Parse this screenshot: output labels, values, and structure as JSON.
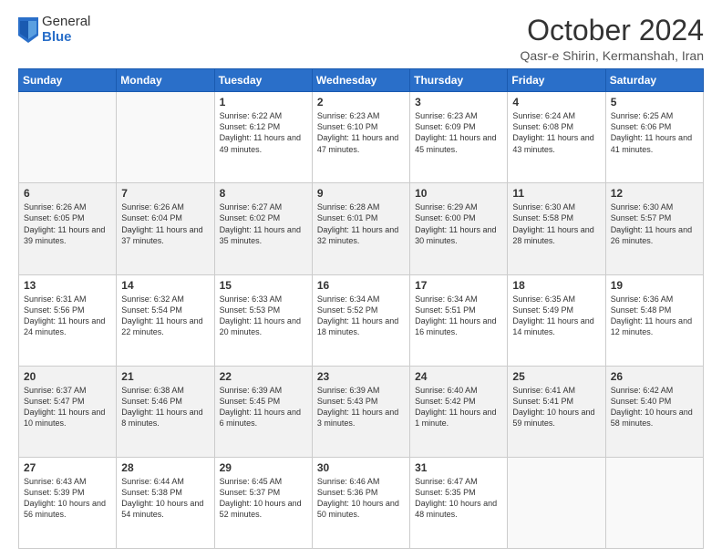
{
  "logo": {
    "general": "General",
    "blue": "Blue"
  },
  "header": {
    "month": "October 2024",
    "location": "Qasr-e Shirin, Kermanshah, Iran"
  },
  "weekdays": [
    "Sunday",
    "Monday",
    "Tuesday",
    "Wednesday",
    "Thursday",
    "Friday",
    "Saturday"
  ],
  "weeks": [
    [
      {
        "day": "",
        "info": ""
      },
      {
        "day": "",
        "info": ""
      },
      {
        "day": "1",
        "info": "Sunrise: 6:22 AM\nSunset: 6:12 PM\nDaylight: 11 hours and 49 minutes."
      },
      {
        "day": "2",
        "info": "Sunrise: 6:23 AM\nSunset: 6:10 PM\nDaylight: 11 hours and 47 minutes."
      },
      {
        "day": "3",
        "info": "Sunrise: 6:23 AM\nSunset: 6:09 PM\nDaylight: 11 hours and 45 minutes."
      },
      {
        "day": "4",
        "info": "Sunrise: 6:24 AM\nSunset: 6:08 PM\nDaylight: 11 hours and 43 minutes."
      },
      {
        "day": "5",
        "info": "Sunrise: 6:25 AM\nSunset: 6:06 PM\nDaylight: 11 hours and 41 minutes."
      }
    ],
    [
      {
        "day": "6",
        "info": "Sunrise: 6:26 AM\nSunset: 6:05 PM\nDaylight: 11 hours and 39 minutes."
      },
      {
        "day": "7",
        "info": "Sunrise: 6:26 AM\nSunset: 6:04 PM\nDaylight: 11 hours and 37 minutes."
      },
      {
        "day": "8",
        "info": "Sunrise: 6:27 AM\nSunset: 6:02 PM\nDaylight: 11 hours and 35 minutes."
      },
      {
        "day": "9",
        "info": "Sunrise: 6:28 AM\nSunset: 6:01 PM\nDaylight: 11 hours and 32 minutes."
      },
      {
        "day": "10",
        "info": "Sunrise: 6:29 AM\nSunset: 6:00 PM\nDaylight: 11 hours and 30 minutes."
      },
      {
        "day": "11",
        "info": "Sunrise: 6:30 AM\nSunset: 5:58 PM\nDaylight: 11 hours and 28 minutes."
      },
      {
        "day": "12",
        "info": "Sunrise: 6:30 AM\nSunset: 5:57 PM\nDaylight: 11 hours and 26 minutes."
      }
    ],
    [
      {
        "day": "13",
        "info": "Sunrise: 6:31 AM\nSunset: 5:56 PM\nDaylight: 11 hours and 24 minutes."
      },
      {
        "day": "14",
        "info": "Sunrise: 6:32 AM\nSunset: 5:54 PM\nDaylight: 11 hours and 22 minutes."
      },
      {
        "day": "15",
        "info": "Sunrise: 6:33 AM\nSunset: 5:53 PM\nDaylight: 11 hours and 20 minutes."
      },
      {
        "day": "16",
        "info": "Sunrise: 6:34 AM\nSunset: 5:52 PM\nDaylight: 11 hours and 18 minutes."
      },
      {
        "day": "17",
        "info": "Sunrise: 6:34 AM\nSunset: 5:51 PM\nDaylight: 11 hours and 16 minutes."
      },
      {
        "day": "18",
        "info": "Sunrise: 6:35 AM\nSunset: 5:49 PM\nDaylight: 11 hours and 14 minutes."
      },
      {
        "day": "19",
        "info": "Sunrise: 6:36 AM\nSunset: 5:48 PM\nDaylight: 11 hours and 12 minutes."
      }
    ],
    [
      {
        "day": "20",
        "info": "Sunrise: 6:37 AM\nSunset: 5:47 PM\nDaylight: 11 hours and 10 minutes."
      },
      {
        "day": "21",
        "info": "Sunrise: 6:38 AM\nSunset: 5:46 PM\nDaylight: 11 hours and 8 minutes."
      },
      {
        "day": "22",
        "info": "Sunrise: 6:39 AM\nSunset: 5:45 PM\nDaylight: 11 hours and 6 minutes."
      },
      {
        "day": "23",
        "info": "Sunrise: 6:39 AM\nSunset: 5:43 PM\nDaylight: 11 hours and 3 minutes."
      },
      {
        "day": "24",
        "info": "Sunrise: 6:40 AM\nSunset: 5:42 PM\nDaylight: 11 hours and 1 minute."
      },
      {
        "day": "25",
        "info": "Sunrise: 6:41 AM\nSunset: 5:41 PM\nDaylight: 10 hours and 59 minutes."
      },
      {
        "day": "26",
        "info": "Sunrise: 6:42 AM\nSunset: 5:40 PM\nDaylight: 10 hours and 58 minutes."
      }
    ],
    [
      {
        "day": "27",
        "info": "Sunrise: 6:43 AM\nSunset: 5:39 PM\nDaylight: 10 hours and 56 minutes."
      },
      {
        "day": "28",
        "info": "Sunrise: 6:44 AM\nSunset: 5:38 PM\nDaylight: 10 hours and 54 minutes."
      },
      {
        "day": "29",
        "info": "Sunrise: 6:45 AM\nSunset: 5:37 PM\nDaylight: 10 hours and 52 minutes."
      },
      {
        "day": "30",
        "info": "Sunrise: 6:46 AM\nSunset: 5:36 PM\nDaylight: 10 hours and 50 minutes."
      },
      {
        "day": "31",
        "info": "Sunrise: 6:47 AM\nSunset: 5:35 PM\nDaylight: 10 hours and 48 minutes."
      },
      {
        "day": "",
        "info": ""
      },
      {
        "day": "",
        "info": ""
      }
    ]
  ]
}
